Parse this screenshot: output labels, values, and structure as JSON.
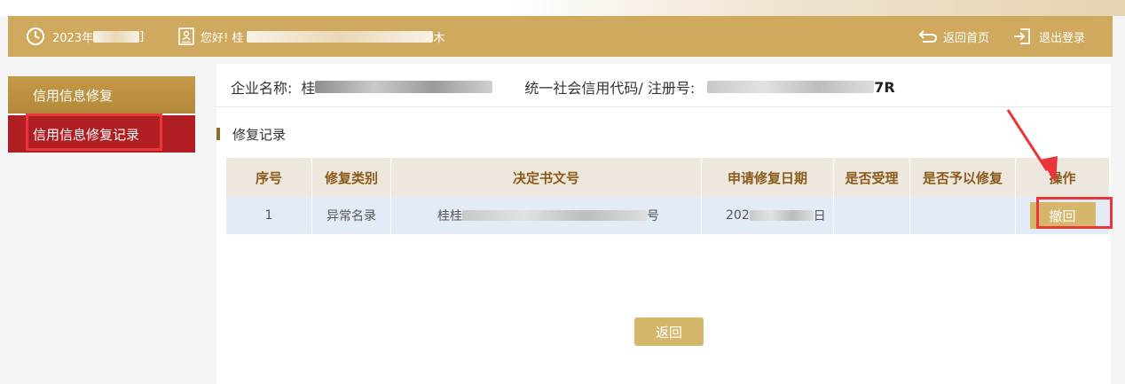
{
  "header": {
    "date_prefix": "2023年",
    "date_suffix": "]",
    "greeting_prefix": "您好! 桂",
    "greeting_suffix": "木",
    "home_label": "返回首页",
    "logout_label": "退出登录",
    "icons": [
      "clock-icon",
      "user-badge-icon",
      "return-icon",
      "logout-icon"
    ]
  },
  "sidebar": {
    "items": [
      {
        "label": "信用信息修复",
        "active": false
      },
      {
        "label": "信用信息修复记录",
        "active": true
      }
    ]
  },
  "company": {
    "name_label": "企业名称:",
    "name_value_prefix": "桂",
    "credit_label": "统一社会信用代码/ 注册号:",
    "credit_value_suffix": "7R"
  },
  "section": {
    "title": "修复记录"
  },
  "table": {
    "headers": [
      "序号",
      "修复类别",
      "决定书文号",
      "申请修复日期",
      "是否受理",
      "是否予以修复",
      "操作"
    ],
    "rows": [
      {
        "index": "1",
        "category": "异常名录",
        "doc_prefix": "桂桂",
        "doc_suffix": "号",
        "date_prefix": "202",
        "date_suffix": "日",
        "accepted": "",
        "repaired": "",
        "action": "撤回"
      }
    ]
  },
  "footer": {
    "back_label": "返回"
  },
  "colors": {
    "header_bg": "#cfa95e",
    "sidebar_active": "#b01e23",
    "sidebar_item": "#b3883a",
    "table_head_bg": "#eee7dd",
    "table_row_bg": "#e3ebf6",
    "button_bg": "#d5b66a",
    "annotation": "#e8363a"
  }
}
